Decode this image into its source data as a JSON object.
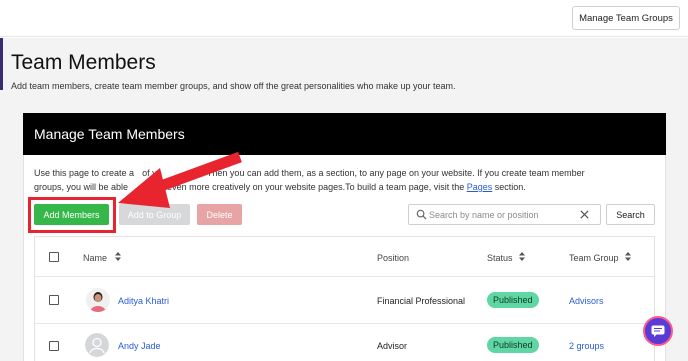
{
  "topbar": {
    "manage_groups_label": "Manage Team Groups"
  },
  "page": {
    "title": "Team Members",
    "subtitle": "Add team members, create team member groups, and show off the great personalities who make up your team."
  },
  "card": {
    "title": "Manage Team Members",
    "desc_part1": "Use this page to create a",
    "desc_part1b": "of yo",
    "desc_part2": "ers. Then you can add them, as a section, to any page on your website. If you create team member",
    "desc_line2a": "groups, you will be able",
    "desc_line2b": "em even more creatively on your website pages.To build a team page, visit the ",
    "desc_link": "Pages",
    "desc_line2c": " section."
  },
  "actions": {
    "add_label": "Add Members",
    "group_label": "Add to Group",
    "delete_label": "Delete",
    "search_placeholder": "Search by name or position",
    "search_label": "Search"
  },
  "table": {
    "headers": {
      "name": "Name",
      "position": "Position",
      "status": "Status",
      "team_group": "Team Group"
    },
    "rows": [
      {
        "name": "Aditya Khatri",
        "position": "Financial Professional",
        "status": "Published",
        "team_group": "Advisors"
      },
      {
        "name": "Andy Jade",
        "position": "Advisor",
        "status": "Published",
        "team_group": "2 groups"
      }
    ]
  },
  "colors": {
    "accent_green": "#35b849",
    "highlight_red": "#e8242f",
    "link_blue": "#2a5bd7",
    "badge_green": "#5fd6a4"
  }
}
